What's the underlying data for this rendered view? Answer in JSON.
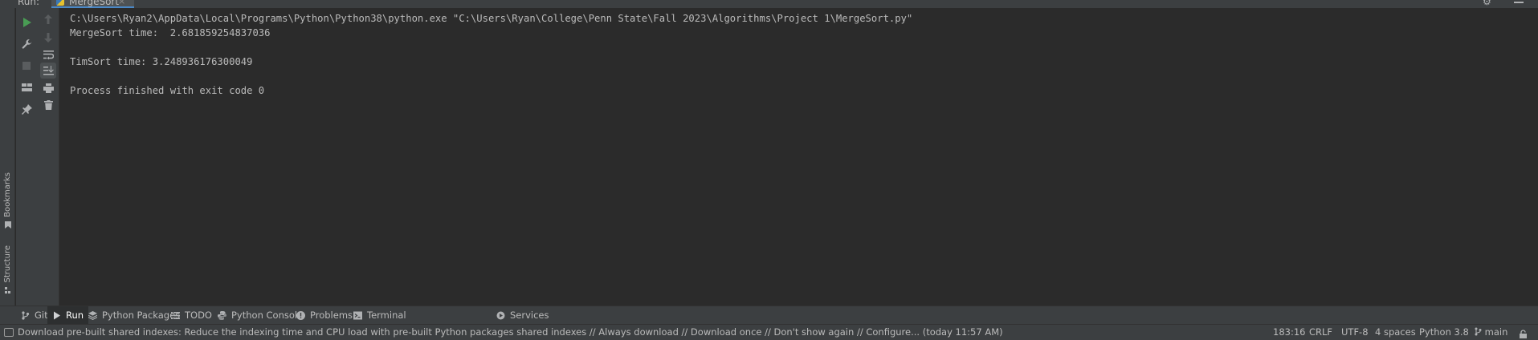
{
  "run_header": {
    "label": "Run:",
    "tab_label": "MergeSort",
    "tab_close": "×"
  },
  "left_stripe": {
    "bookmarks_label": "Bookmarks",
    "structure_label": "Structure"
  },
  "console": {
    "lines": [
      "C:\\Users\\Ryan2\\AppData\\Local\\Programs\\Python\\Python38\\python.exe \"C:\\Users\\Ryan\\College\\Penn State\\Fall 2023\\Algorithms\\Project 1\\MergeSort.py\"",
      "MergeSort time:  2.681859254837036",
      "",
      "TimSort time: 3.248936176300049",
      "",
      "Process finished with exit code 0"
    ]
  },
  "tool_windows": [
    {
      "label": "Git",
      "icon": "git-branch-icon"
    },
    {
      "label": "Run",
      "icon": "play-icon"
    },
    {
      "label": "Python Packages",
      "icon": "layers-icon"
    },
    {
      "label": "TODO",
      "icon": "list-icon"
    },
    {
      "label": "Python Console",
      "icon": "python-icon"
    },
    {
      "label": "Problems",
      "icon": "info-icon"
    },
    {
      "label": "Terminal",
      "icon": "terminal-icon"
    },
    {
      "label": "Services",
      "icon": "services-icon"
    }
  ],
  "status": {
    "message": "Download pre-built shared indexes: Reduce the indexing time and CPU load with pre-built Python packages shared indexes // Always download // Download once // Don't show again // Configure... (today 11:57 AM)",
    "position": "183:16",
    "line_sep": "CRLF",
    "encoding": "UTF-8",
    "indent": "4 spaces",
    "interpreter": "Python 3.8",
    "branch": "main"
  },
  "colors": {
    "background": "#2b2b2b",
    "panel": "#3c3f41",
    "text": "#bbbbbb",
    "run_green": "#499c54",
    "accent_blue": "#4a88c7"
  }
}
